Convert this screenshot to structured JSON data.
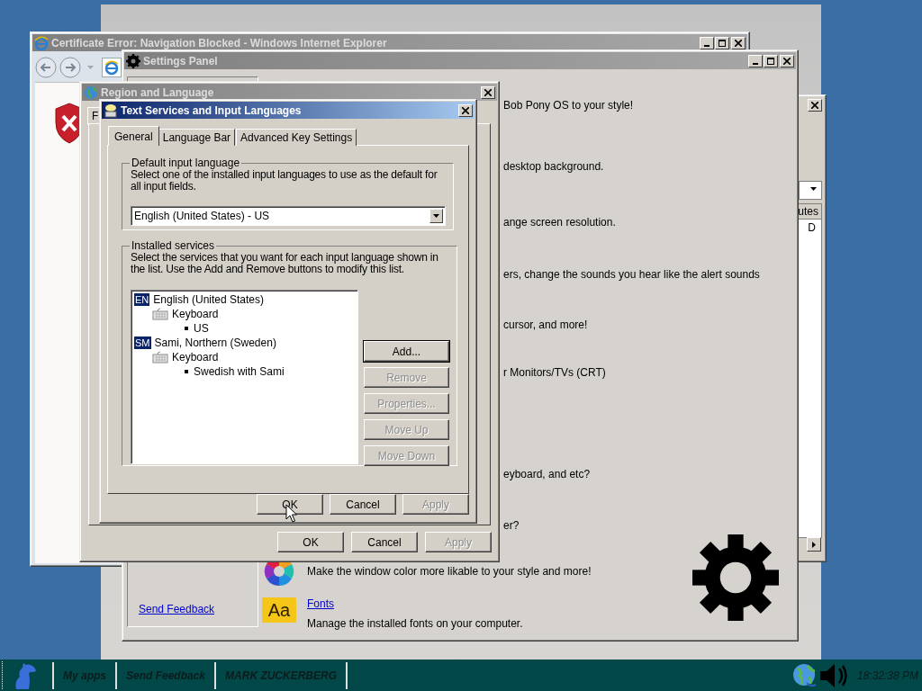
{
  "background_window": {
    "column_header": "utes",
    "cell": "D"
  },
  "browser": {
    "title": "Certificate Error: Navigation Blocked - Windows Internet Explorer"
  },
  "settings_panel": {
    "title": "Settings Panel",
    "descriptions": [
      "Bob Pony OS to your style!",
      "desktop background.",
      "ange screen resolution.",
      "ers, change the sounds you hear like the alert sounds",
      "cursor, and more!",
      "r Monitors/TVs (CRT)",
      "eyboard, and etc?",
      "er?"
    ],
    "items": [
      {
        "kind": "color",
        "description": "Make the window color more likable to your style and more!"
      },
      {
        "kind": "fonts",
        "icon_text": "Aa",
        "link": "Fonts",
        "description": "Manage the installed fonts on your computer."
      }
    ],
    "sidebar_link": "Send Feedback"
  },
  "region_dialog": {
    "title": "Region and Language",
    "tab_fragment": "F",
    "buttons": [
      {
        "label": "OK",
        "disabled": false
      },
      {
        "label": "Cancel",
        "disabled": false
      },
      {
        "label": "Apply",
        "disabled": true
      }
    ]
  },
  "text_services": {
    "title": "Text Services and Input Languages",
    "tabs": [
      {
        "label": "General",
        "selected": true
      },
      {
        "label": "Language Bar",
        "selected": false
      },
      {
        "label": "Advanced Key Settings",
        "selected": false
      }
    ],
    "default_language": {
      "legend": "Default input language",
      "description": "Select one of the installed input languages to use as the default for all input fields.",
      "value": "English (United States) - US"
    },
    "installed_services": {
      "legend": "Installed services",
      "description": "Select the services that you want for each input language shown in the list. Use the Add and Remove buttons to modify this list.",
      "languages": [
        {
          "badge": "EN",
          "label": "English (United States)",
          "children": [
            {
              "label": "Keyboard",
              "children": [
                {
                  "label": "US"
                }
              ]
            }
          ]
        },
        {
          "badge": "SM",
          "label": "Sami, Northern (Sweden)",
          "children": [
            {
              "label": "Keyboard",
              "children": [
                {
                  "label": "Swedish with Sami"
                }
              ]
            }
          ]
        }
      ],
      "side_buttons": [
        {
          "label": "Add...",
          "disabled": false,
          "default": true
        },
        {
          "label": "Remove",
          "disabled": true,
          "default": false
        },
        {
          "label": "Properties...",
          "disabled": true,
          "default": false
        },
        {
          "label": "Move Up",
          "disabled": true,
          "default": false
        },
        {
          "label": "Move Down",
          "disabled": true,
          "default": false
        }
      ]
    },
    "buttons": [
      {
        "label": "OK",
        "disabled": false
      },
      {
        "label": "Cancel",
        "disabled": false
      },
      {
        "label": "Apply",
        "disabled": true
      }
    ]
  },
  "taskbar": {
    "items": [
      "My apps",
      "Send Feedback",
      "MARK ZUCKERBERG"
    ],
    "clock": "18:32:38 PM"
  }
}
